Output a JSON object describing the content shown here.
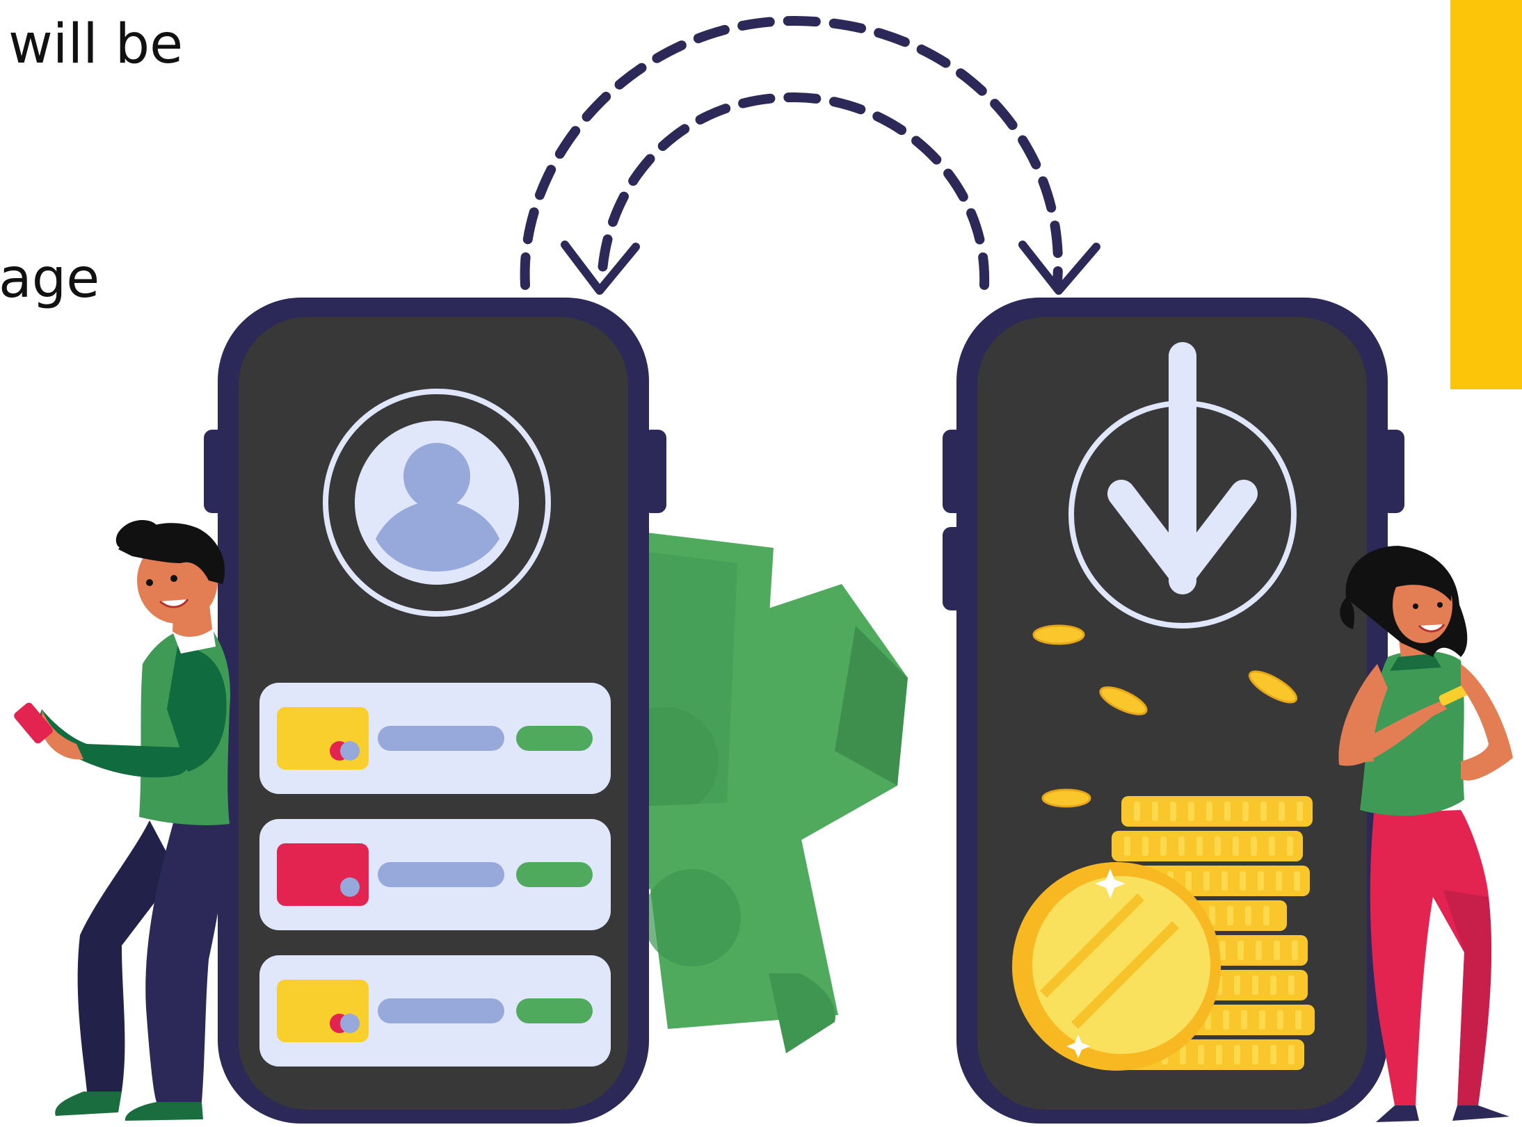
{
  "caption": {
    "line_1": "will be",
    "line_2": "age"
  },
  "colors": {
    "accent_yellow": "#fdc50a",
    "phone_frame": "#2c2857",
    "phone_screen": "#383838",
    "card_bg": "#e1e7fa",
    "arrow_dash": "#2c2857",
    "cash_green": "#4faa5e",
    "coin_gold": "#f9c72c"
  },
  "icons": {
    "left_phone_avatar": "user-avatar-icon",
    "right_phone_arrow": "download-arrow-icon",
    "transfer_arrows": "dashed-transfer-arrows"
  },
  "payment_cards": [
    {
      "card_color": "#f9cf2e",
      "pill_1": "#97a8da",
      "pill_2": "#4faa5e"
    },
    {
      "card_color": "#e32350",
      "pill_1": "#97a8da",
      "pill_2": "#4faa5e"
    },
    {
      "card_color": "#f9cf2e",
      "pill_1": "#97a8da",
      "pill_2": "#4faa5e"
    }
  ]
}
